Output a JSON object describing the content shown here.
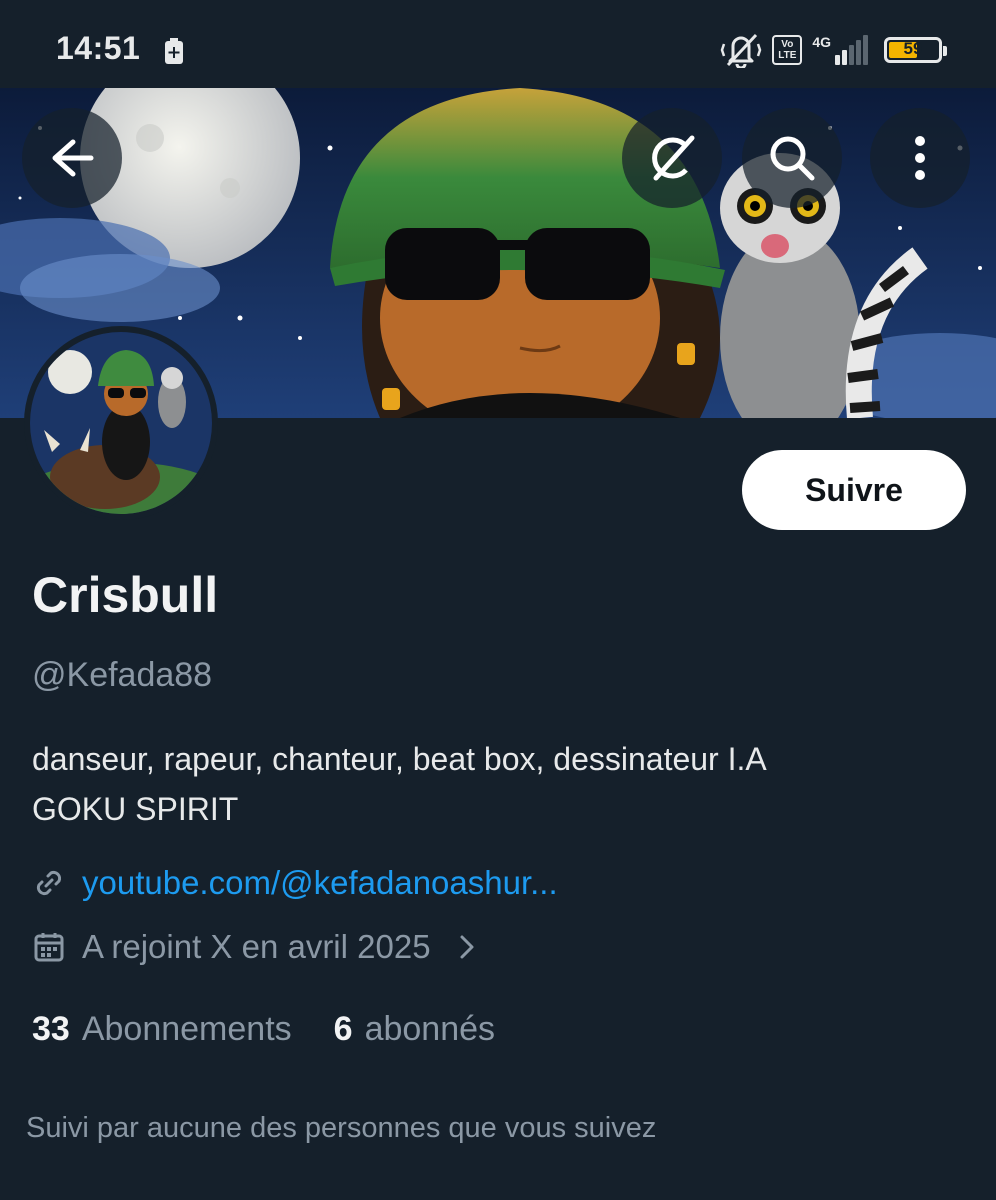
{
  "status_bar": {
    "time": "14:51",
    "volte_top": "Vo",
    "volte_bottom": "LTE",
    "network": "4G",
    "battery_level": "59",
    "icons": [
      "battery-saver-icon",
      "vibrate-off-icon",
      "volte-icon",
      "signal-icon",
      "battery-icon"
    ]
  },
  "header": {
    "back_icon": "back-arrow-icon",
    "grok_icon": "grok-icon",
    "search_icon": "search-icon",
    "more_icon": "more-vertical-icon"
  },
  "profile": {
    "display_name": "Crisbull",
    "handle": "@Kefada88",
    "bio_lines": [
      "danseur, rapeur, chanteur, beat box, dessinateur I.A",
      "GOKU SPIRIT"
    ],
    "link": "youtube.com/@kefadanoashur...",
    "joined": "A rejoint X en avril 2025",
    "follow_label": "Suivre",
    "following_count": "33",
    "following_label": "Abonnements",
    "followers_count": "6",
    "followers_label": "abonnés",
    "followed_by": "Suivi par aucune des personnes que vous suivez"
  },
  "colors": {
    "background": "#15202b",
    "link": "#1d9bf0",
    "muted": "#8b98a5",
    "battery": "#f4b400"
  }
}
